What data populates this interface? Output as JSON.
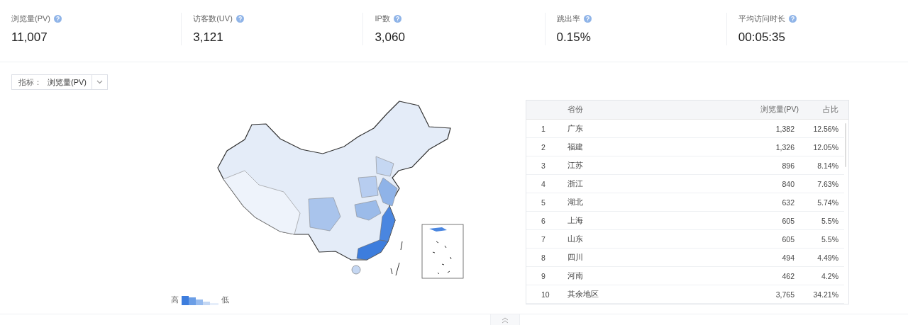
{
  "stats": [
    {
      "label": "浏览量(PV)",
      "value": "11,007"
    },
    {
      "label": "访客数(UV)",
      "value": "3,121"
    },
    {
      "label": "IP数",
      "value": "3,060"
    },
    {
      "label": "跳出率",
      "value": "0.15%"
    },
    {
      "label": "平均访问时长",
      "value": "00:05:35"
    }
  ],
  "metric_select": {
    "label": "指标：",
    "value": "浏览量(PV)"
  },
  "legend": {
    "high": "高",
    "low": "低"
  },
  "table": {
    "columns": [
      "省份",
      "浏览量(PV)",
      "占比"
    ],
    "rows": [
      {
        "rank": "1",
        "province": "广东",
        "pv": "1,382",
        "share": "12.56%"
      },
      {
        "rank": "2",
        "province": "福建",
        "pv": "1,326",
        "share": "12.05%"
      },
      {
        "rank": "3",
        "province": "江苏",
        "pv": "896",
        "share": "8.14%"
      },
      {
        "rank": "4",
        "province": "浙江",
        "pv": "840",
        "share": "7.63%"
      },
      {
        "rank": "5",
        "province": "湖北",
        "pv": "632",
        "share": "5.74%"
      },
      {
        "rank": "6",
        "province": "上海",
        "pv": "605",
        "share": "5.5%"
      },
      {
        "rank": "7",
        "province": "山东",
        "pv": "605",
        "share": "5.5%"
      },
      {
        "rank": "8",
        "province": "四川",
        "pv": "494",
        "share": "4.49%"
      },
      {
        "rank": "9",
        "province": "河南",
        "pv": "462",
        "share": "4.2%"
      },
      {
        "rank": "10",
        "province": "其余地区",
        "pv": "3,765",
        "share": "34.21%"
      }
    ]
  }
}
